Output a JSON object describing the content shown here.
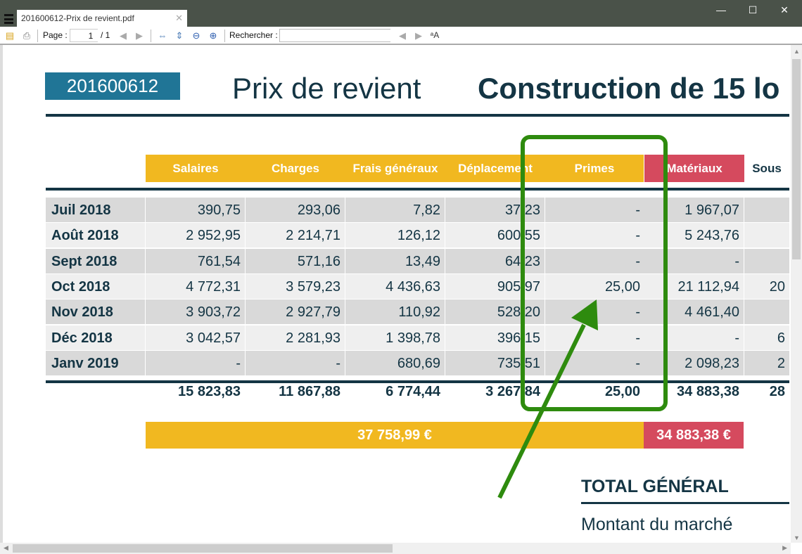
{
  "window": {
    "tab_title": "201600612-Prix de revient.pdf",
    "minimize": "—",
    "maximize": "☐",
    "close": "✕",
    "tab_close": "✕"
  },
  "toolbar": {
    "page_label": "Page :",
    "page_value": "1",
    "page_total": "/ 1",
    "search_label": "Rechercher :",
    "search_value": ""
  },
  "document": {
    "reference": "201600612",
    "title": "Prix de revient",
    "project": "Construction de 15 lo",
    "columns": [
      {
        "label": "Salaires",
        "color": "#f1b820"
      },
      {
        "label": "Charges",
        "color": "#f1b820"
      },
      {
        "label": "Frais généraux",
        "color": "#f1b820"
      },
      {
        "label": "Déplacement",
        "color": "#f1b820"
      },
      {
        "label": "Primes",
        "color": "#f1b820"
      },
      {
        "label": "Matériaux",
        "color": "#d54a5e"
      },
      {
        "label": "Sous",
        "color": "#ffffff"
      }
    ],
    "rows": [
      {
        "month": "Juil 2018",
        "values": [
          "390,75",
          "293,06",
          "7,82",
          "37,23",
          "-",
          "1 967,07",
          ""
        ]
      },
      {
        "month": "Août 2018",
        "values": [
          "2 952,95",
          "2 214,71",
          "126,12",
          "600,55",
          "-",
          "5 243,76",
          ""
        ]
      },
      {
        "month": "Sept 2018",
        "values": [
          "761,54",
          "571,16",
          "13,49",
          "64,23",
          "-",
          "-",
          ""
        ]
      },
      {
        "month": "Oct 2018",
        "values": [
          "4 772,31",
          "3 579,23",
          "4 436,63",
          "905,97",
          "25,00",
          "21 112,94",
          "20"
        ]
      },
      {
        "month": "Nov 2018",
        "values": [
          "3 903,72",
          "2 927,79",
          "110,92",
          "528,20",
          "-",
          "4 461,40",
          ""
        ]
      },
      {
        "month": "Déc 2018",
        "values": [
          "3 042,57",
          "2 281,93",
          "1 398,78",
          "396,15",
          "-",
          "-",
          "6"
        ]
      },
      {
        "month": "Janv 2019",
        "values": [
          "-",
          "-",
          "680,69",
          "735,51",
          "-",
          "2 098,23",
          "2"
        ]
      }
    ],
    "totals": [
      "15 823,83",
      "11 867,88",
      "6 774,44",
      "3 267,84",
      "25,00",
      "34 883,38",
      "28"
    ],
    "summary_labour": "37 758,99 €",
    "summary_materials": "34 883,38 €",
    "total_general_heading": "TOTAL GÉNÉRAL",
    "montant_label": "Montant du marché"
  },
  "annotation": {
    "color": "#2e8b0e"
  }
}
